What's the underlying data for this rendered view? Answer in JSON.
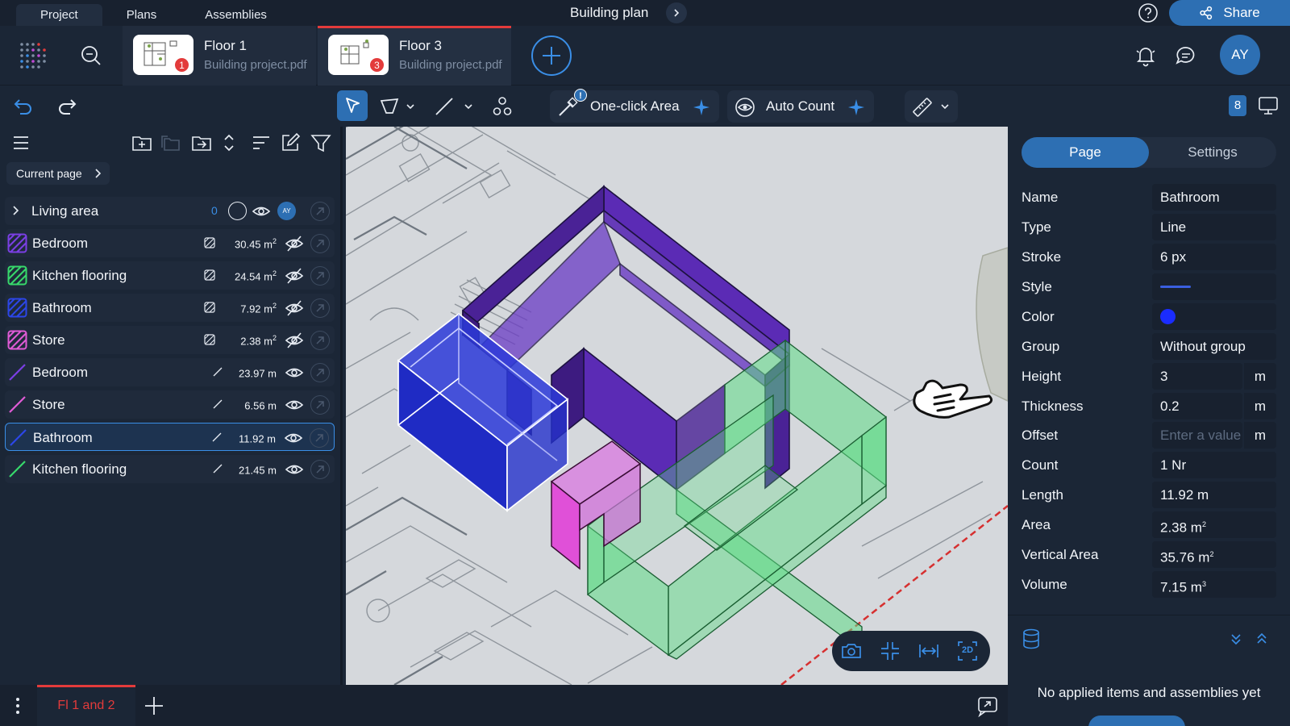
{
  "top_tabs": [
    {
      "label": "Project",
      "active": true
    },
    {
      "label": "Plans",
      "active": false
    },
    {
      "label": "Assemblies",
      "active": false
    }
  ],
  "document_title": "Building plan",
  "share_label": "Share",
  "files": [
    {
      "name": "Floor 1",
      "subtitle": "Building project.pdf",
      "badge": "1",
      "active": false
    },
    {
      "name": "Floor 3",
      "subtitle": "Building project.pdf",
      "badge": "3",
      "active": true
    }
  ],
  "avatar_initials": "AY",
  "toolbar": {
    "one_click_label": "One-click Area",
    "one_click_warning": "!",
    "auto_count_label": "Auto Count",
    "badge_count": "8"
  },
  "left_panel": {
    "current_page_label": "Current page",
    "group": {
      "label": "Living area",
      "count": "0",
      "owner": "AY"
    },
    "items": [
      {
        "label": "Bedroom",
        "kind": "area",
        "qty": "30.45 m",
        "unit_sup": "2",
        "color": "#7b3fe4",
        "hidden": true,
        "selected": false
      },
      {
        "label": "Kitchen flooring",
        "kind": "area",
        "qty": "24.54 m",
        "unit_sup": "2",
        "color": "#37d96b",
        "hidden": true,
        "selected": false
      },
      {
        "label": "Bathroom",
        "kind": "area",
        "qty": "7.92 m",
        "unit_sup": "2",
        "color": "#2c46e8",
        "hidden": true,
        "selected": false
      },
      {
        "label": "Store",
        "kind": "area",
        "qty": "2.38 m",
        "unit_sup": "2",
        "color": "#e05bd6",
        "hidden": true,
        "selected": false
      },
      {
        "label": "Bedroom",
        "kind": "line",
        "qty": "23.97 m",
        "unit_sup": "",
        "color": "#7b3fe4",
        "hidden": false,
        "selected": false
      },
      {
        "label": "Store",
        "kind": "line",
        "qty": "6.56 m",
        "unit_sup": "",
        "color": "#e05bd6",
        "hidden": false,
        "selected": false
      },
      {
        "label": "Bathroom",
        "kind": "line",
        "qty": "11.92 m",
        "unit_sup": "",
        "color": "#2c46e8",
        "hidden": false,
        "selected": true
      },
      {
        "label": "Kitchen flooring",
        "kind": "line",
        "qty": "21.45 m",
        "unit_sup": "",
        "color": "#37d96b",
        "hidden": false,
        "selected": false
      }
    ]
  },
  "right_panel": {
    "tabs": [
      {
        "label": "Page",
        "active": true
      },
      {
        "label": "Settings",
        "active": false
      }
    ],
    "props": {
      "name_label": "Name",
      "name_value": "Bathroom",
      "type_label": "Type",
      "type_value": "Line",
      "stroke_label": "Stroke",
      "stroke_value": "6 px",
      "style_label": "Style",
      "color_label": "Color",
      "color_value": "#1a2cff",
      "group_label": "Group",
      "group_value": "Without group",
      "height_label": "Height",
      "height_value": "3",
      "height_unit": "m",
      "thickness_label": "Thickness",
      "thickness_value": "0.2",
      "thickness_unit": "m",
      "offset_label": "Offset",
      "offset_placeholder": "Enter a value",
      "offset_unit": "m",
      "count_label": "Count",
      "count_value": "1 Nr",
      "length_label": "Length",
      "length_value": "11.92 m",
      "area_label": "Area",
      "area_value": "2.38 m",
      "area_sup": "2",
      "vertical_area_label": "Vertical Area",
      "vertical_area_value": "35.76 m",
      "vertical_area_sup": "2",
      "volume_label": "Volume",
      "volume_value": "7.15 m",
      "volume_sup": "3"
    },
    "empty_message": "No applied items and assemblies yet"
  },
  "bottom_bar": {
    "sheet_tab": "Fl 1 and 2"
  },
  "view_controls": {
    "mode_label": "2D"
  }
}
